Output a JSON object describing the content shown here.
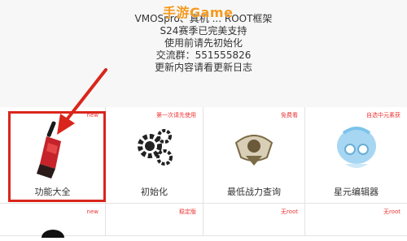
{
  "header": {
    "watermark": "手游Game",
    "lines": [
      "VMOSpro、真机 ... ROOT框架",
      "S24赛季已完美支持",
      "使用前请先初始化",
      "交流群：551555826",
      "更新内容请看更新日志"
    ]
  },
  "grid": {
    "row1": [
      {
        "label": "功能大全",
        "badge": "new",
        "icon": "torch-brush-icon"
      },
      {
        "label": "初始化",
        "badge": "第一次请先使用",
        "icon": "gears-icon"
      },
      {
        "label": "最低战力查询",
        "badge": "免费看",
        "icon": "emblem-icon"
      },
      {
        "label": "星元编辑器",
        "badge": "自选中元素获",
        "icon": "anime-character-icon"
      }
    ],
    "row2": [
      {
        "badge": "new"
      },
      {
        "badge": "稳定版"
      },
      {
        "badge": "无root"
      },
      {
        "badge": "无root"
      }
    ]
  },
  "colors": {
    "accent_red": "#d9261c",
    "watermark_orange": "#f39a1f"
  }
}
